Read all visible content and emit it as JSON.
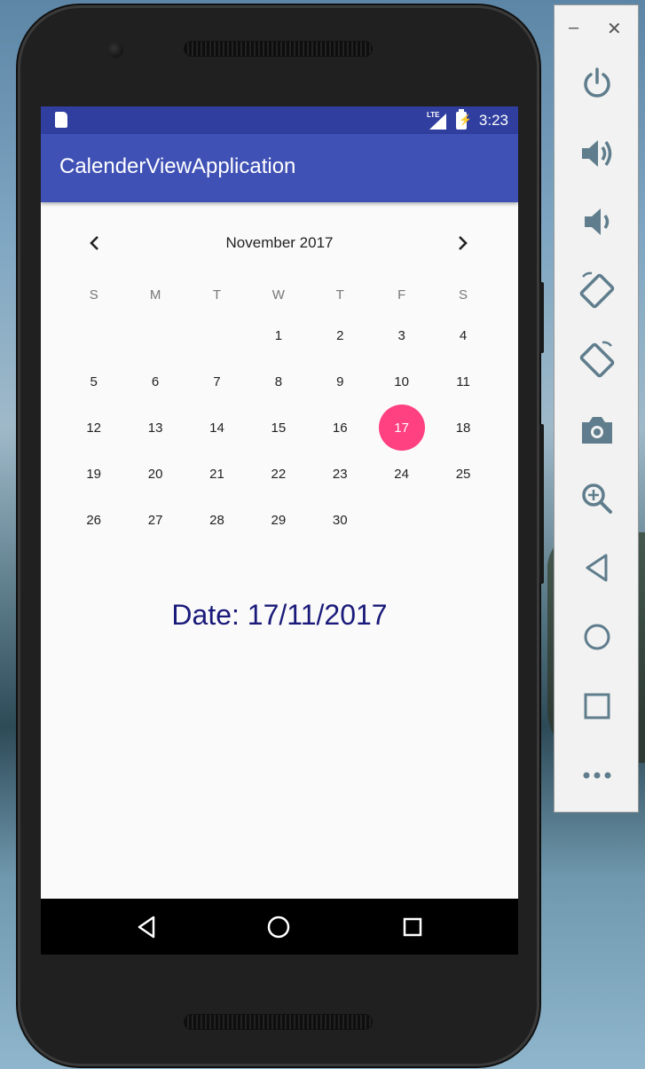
{
  "status_bar": {
    "time": "3:23",
    "network": "LTE"
  },
  "app": {
    "title": "CalenderViewApplication"
  },
  "calendar": {
    "month_label": "November 2017",
    "weekdays": [
      "S",
      "M",
      "T",
      "W",
      "T",
      "F",
      "S"
    ],
    "weeks": [
      [
        "",
        "",
        "",
        "1",
        "2",
        "3",
        "4"
      ],
      [
        "5",
        "6",
        "7",
        "8",
        "9",
        "10",
        "11"
      ],
      [
        "12",
        "13",
        "14",
        "15",
        "16",
        "17",
        "18"
      ],
      [
        "19",
        "20",
        "21",
        "22",
        "23",
        "24",
        "25"
      ],
      [
        "26",
        "27",
        "28",
        "29",
        "30",
        "",
        ""
      ]
    ],
    "selected_day": "17",
    "selected_color": "#ff4081"
  },
  "result": {
    "date_text": "Date: 17/11/2017"
  },
  "colors": {
    "primary": "#3f51b5",
    "primary_dark": "#303f9f",
    "accent": "#ff4081",
    "date_text": "#1a1a7a"
  },
  "emulator_toolbar": {
    "minimize": "–",
    "close": "✕",
    "buttons": [
      "power-icon",
      "volume-up-icon",
      "volume-down-icon",
      "rotate-left-icon",
      "rotate-right-icon",
      "camera-icon",
      "zoom-icon",
      "back-icon",
      "home-icon",
      "overview-icon",
      "more-icon"
    ]
  }
}
